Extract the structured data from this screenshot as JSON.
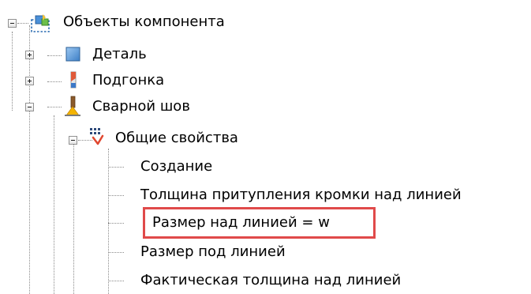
{
  "tree": {
    "root": {
      "label": "Объекты компонента",
      "icon": "component-objects-icon",
      "expanded": true
    },
    "children": [
      {
        "label": "Деталь",
        "icon": "detail-icon",
        "expanded": false
      },
      {
        "label": "Подгонка",
        "icon": "fitting-icon",
        "expanded": false
      },
      {
        "label": "Сварной шов",
        "icon": "weld-seam-icon",
        "expanded": true,
        "children": [
          {
            "label": "Общие свойства",
            "icon": "general-properties-icon",
            "expanded": true,
            "properties": [
              "Создание",
              "Толщина притупления кромки над линией",
              "Размер над линией = w",
              "Размер под линией",
              "Фактическая толщина над линией"
            ]
          }
        ]
      }
    ]
  },
  "highlight": {
    "color": "#e04a4a",
    "item": "Размер над линией = w"
  }
}
